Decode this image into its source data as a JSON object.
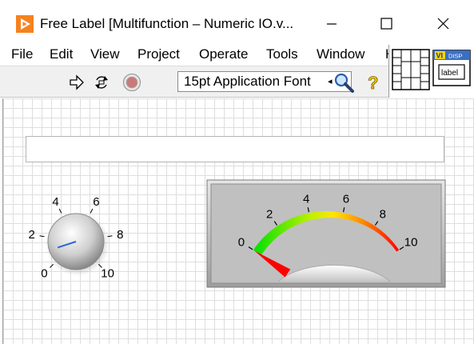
{
  "window": {
    "title": "Free Label [Multifunction – Numeric IO.v...",
    "minimize_glyph": "—",
    "maximize_glyph": "☐",
    "close_glyph": "✕"
  },
  "menu": {
    "items": [
      "File",
      "Edit",
      "View",
      "Project",
      "Operate",
      "Tools",
      "Window",
      "H"
    ]
  },
  "toolbar": {
    "font_select_value": "15pt Application Font",
    "icons": [
      "run-arrow-icon",
      "run-continuously-icon",
      "abort-stop-icon",
      "search-icon",
      "context-help-icon"
    ]
  },
  "palette": {
    "vi_badge": "VI",
    "disp_label": "DISP",
    "label_glyph": "label"
  },
  "front_panel": {
    "free_label_text": "",
    "knob": {
      "value": 1,
      "min": 0,
      "max": 10,
      "scale_labels": [
        "0",
        "2",
        "4",
        "6",
        "8",
        "10"
      ]
    },
    "meter": {
      "value": 0,
      "min": 0,
      "max": 10,
      "scale_labels": [
        "0",
        "2",
        "4",
        "6",
        "8",
        "10"
      ]
    }
  },
  "colors": {
    "accent_orange": "#f5821f",
    "meter_face": "#c0c0c0",
    "needle": "#ff0000",
    "panel_grid": "#dedede"
  }
}
